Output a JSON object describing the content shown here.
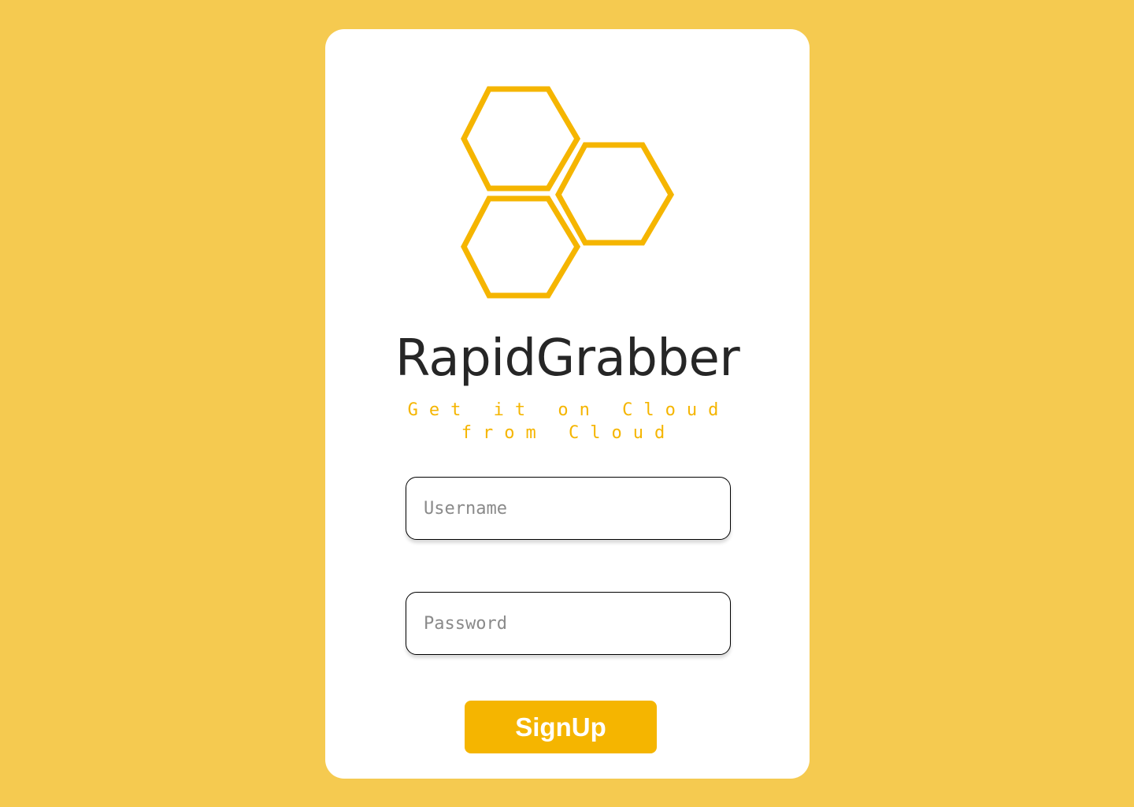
{
  "colors": {
    "background": "#F5CA50",
    "card": "#FFFFFF",
    "accent": "#F5B500",
    "title_text": "#262626",
    "button_text": "#FFFFFF"
  },
  "logo": {
    "icon": "honeycomb-hexagons-logo"
  },
  "app": {
    "title": "RapidGrabber",
    "tagline": "Get it on Cloud\nfrom Cloud"
  },
  "form": {
    "username": {
      "placeholder": "Username",
      "value": ""
    },
    "password": {
      "placeholder": "Password",
      "value": ""
    },
    "signup_label": "SignUp"
  }
}
